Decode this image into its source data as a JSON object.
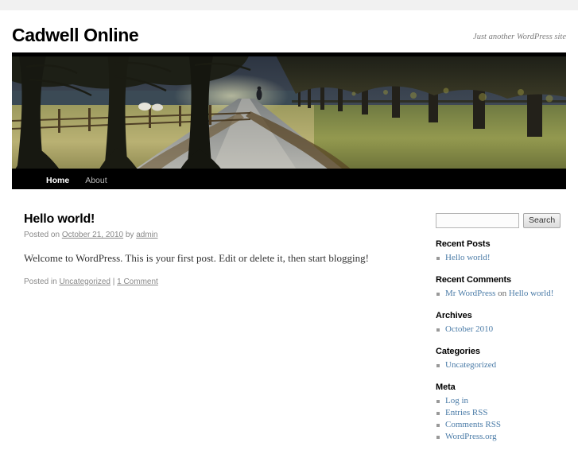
{
  "site": {
    "title": "Cadwell Online",
    "description": "Just another WordPress site"
  },
  "nav": {
    "items": [
      {
        "label": "Home",
        "current": true
      },
      {
        "label": "About",
        "current": false
      }
    ]
  },
  "post": {
    "title": "Hello world!",
    "meta_posted_on": "Posted on ",
    "meta_date": "October 21, 2010",
    "meta_by": " by ",
    "meta_author": "admin",
    "content": "Welcome to WordPress. This is your first post. Edit or delete it, then start blogging!",
    "utility_posted_in": "Posted in ",
    "utility_category": "Uncategorized",
    "utility_sep": " | ",
    "utility_comments": "1 Comment"
  },
  "sidebar": {
    "search": {
      "value": "",
      "placeholder": "",
      "button_label": "Search"
    },
    "widgets": [
      {
        "title": "Recent Posts",
        "items": [
          {
            "link": "Hello world!"
          }
        ]
      },
      {
        "title": "Recent Comments",
        "items": [
          {
            "link": "Mr WordPress",
            "plain": " on ",
            "link2": "Hello world!"
          }
        ]
      },
      {
        "title": "Archives",
        "items": [
          {
            "link": "October 2010"
          }
        ]
      },
      {
        "title": "Categories",
        "items": [
          {
            "link": "Uncategorized"
          }
        ]
      },
      {
        "title": "Meta",
        "items": [
          {
            "link": "Log in"
          },
          {
            "link": "Entries RSS"
          },
          {
            "link": "Comments RSS"
          },
          {
            "link": "WordPress.org"
          }
        ]
      }
    ]
  },
  "colors": {
    "link": "#4a7ba7",
    "nav_bg": "#000000",
    "topbar": "#f1f1f1",
    "meta_text": "#888888"
  },
  "header_image": {
    "name": "tree-lined-path-header",
    "alt": "Tree-lined path with fence and grass"
  }
}
